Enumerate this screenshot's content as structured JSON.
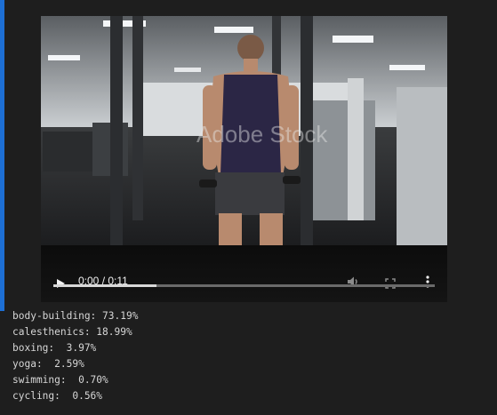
{
  "video": {
    "time_display": "0:00 / 0:11",
    "progress_fraction": 0.27,
    "watermark": "Adobe Stock"
  },
  "predictions": [
    {
      "label": "body-building",
      "text": "body-building: 73.19%"
    },
    {
      "label": "calesthenics",
      "text": "calesthenics: 18.99%"
    },
    {
      "label": "boxing",
      "text": "boxing:  3.97%"
    },
    {
      "label": "yoga",
      "text": "yoga:  2.59%"
    },
    {
      "label": "swimming",
      "text": "swimming:  0.70%"
    },
    {
      "label": "cycling",
      "text": "cycling:  0.56%"
    }
  ],
  "colors": {
    "cell_accent": "#1d6fd4",
    "background": "#1e1e1e"
  },
  "icons": [
    "play-icon",
    "volume-icon",
    "fullscreen-icon",
    "more-options-icon"
  ]
}
